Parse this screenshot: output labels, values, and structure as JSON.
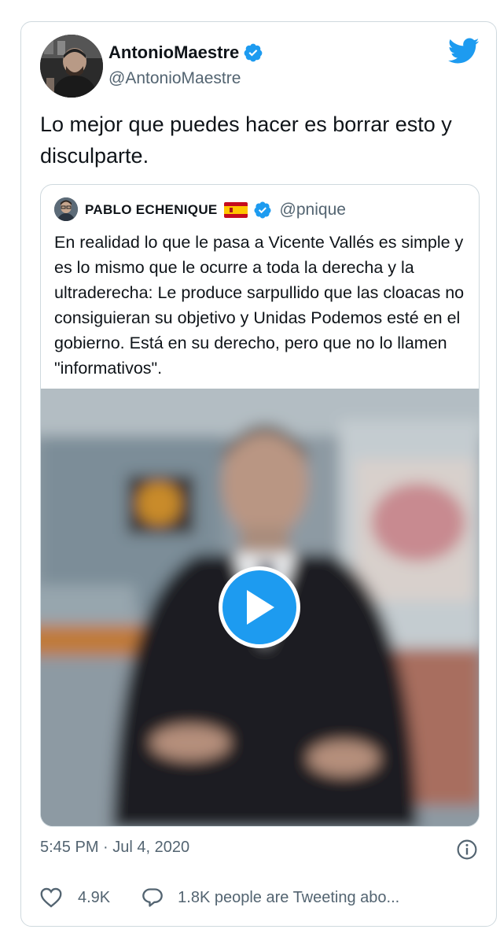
{
  "tweet": {
    "author_name": "AntonioMaestre",
    "author_handle": "@AntonioMaestre",
    "text": "Lo mejor que puedes hacer es borrar esto y disculparte.",
    "timestamp": "5:45 PM · Jul 4, 2020",
    "likes": "4.9K",
    "conversation": "1.8K people are Tweeting abo..."
  },
  "quoted": {
    "author_name": "PABLO ECHENIQUE",
    "author_handle": "@pnique",
    "text": "En realidad lo que le pasa a Vicente Vallés es simple y es lo mismo que le ocurre a toda la derecha y la ultraderecha: Le produce sarpullido que las cloacas no consiguieran su objetivo y Unidas Podemos esté en el gobierno. Está en su derecho, pero que no lo llamen \"informativos\"."
  },
  "icons": {
    "verified": "verified-badge-icon",
    "bird": "twitter-bird-icon",
    "flag": "spain-flag-icon",
    "play": "play-icon",
    "info": "info-icon",
    "like": "heart-icon",
    "reply": "speech-bubble-icon"
  },
  "colors": {
    "accent": "#1d9bf0",
    "text": "#0f1419",
    "secondary": "#536471",
    "border": "#cfd9de"
  }
}
